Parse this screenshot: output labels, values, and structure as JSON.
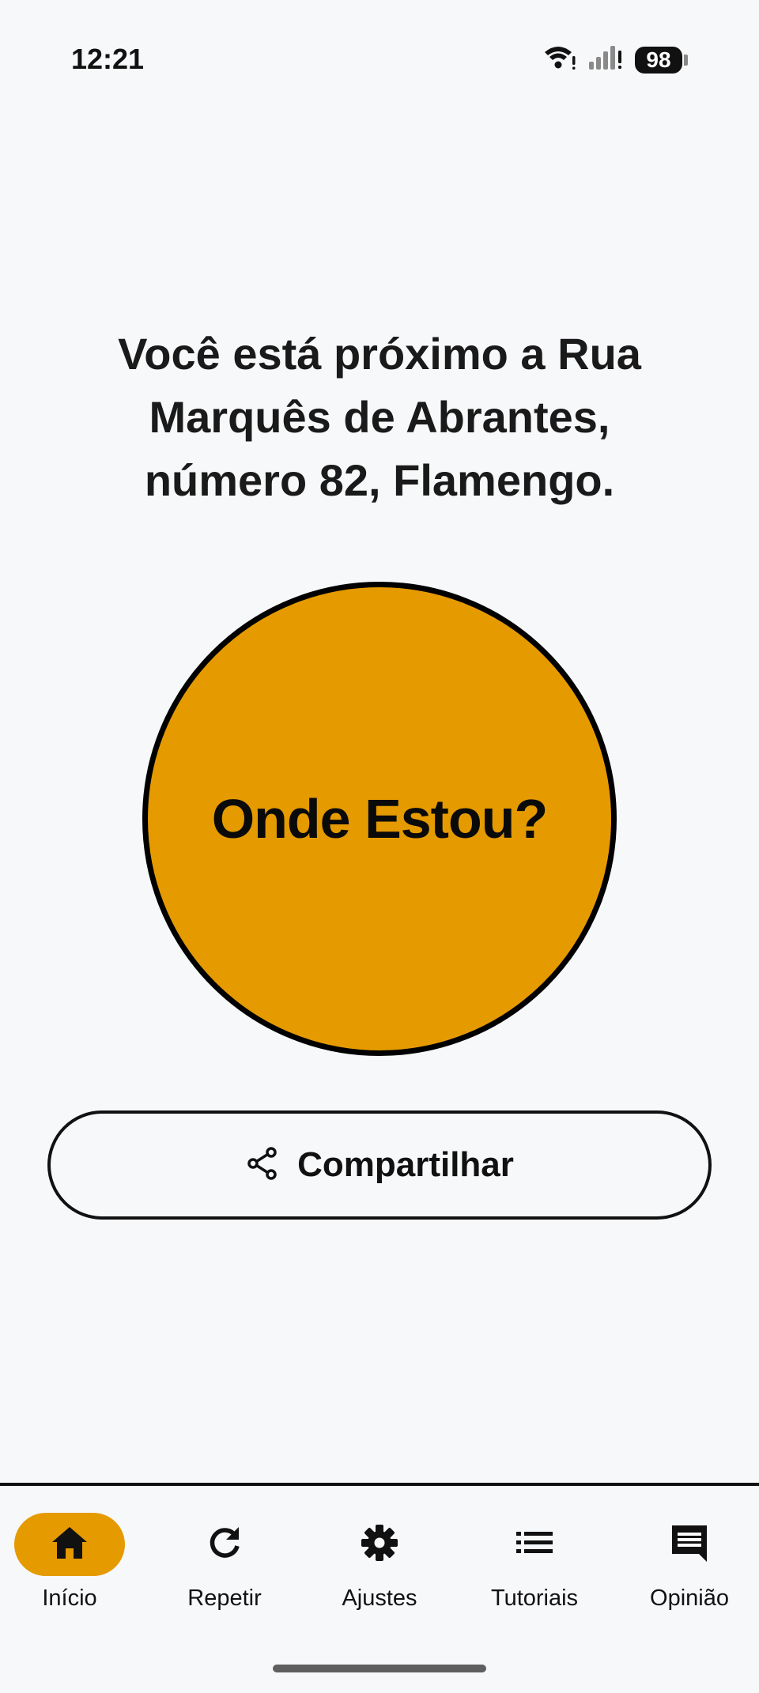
{
  "status_bar": {
    "time": "12:21",
    "battery_level": "98",
    "icons": [
      "wifi-icon",
      "signal-icon",
      "battery-icon"
    ]
  },
  "main": {
    "location_message": "Você está próximo a Rua Marquês de Abrantes, número 82, Flamengo.",
    "primary_button_label": "Onde Estou?",
    "share_button_label": "Compartilhar"
  },
  "bottom_nav": {
    "items": [
      {
        "label": "Início",
        "icon": "home-icon",
        "active": true
      },
      {
        "label": "Repetir",
        "icon": "refresh-icon",
        "active": false
      },
      {
        "label": "Ajustes",
        "icon": "gear-icon",
        "active": false
      },
      {
        "label": "Tutoriais",
        "icon": "list-icon",
        "active": false
      },
      {
        "label": "Opinião",
        "icon": "feedback-icon",
        "active": false
      }
    ]
  },
  "colors": {
    "accent": "#e59a00",
    "background": "#f7f8fa",
    "text": "#111111"
  }
}
